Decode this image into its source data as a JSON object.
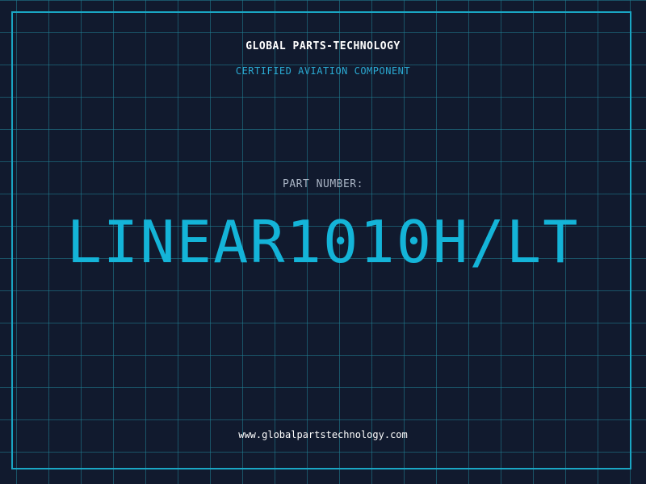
{
  "header": {
    "company_name": "GLOBAL PARTS-TECHNOLOGY",
    "tagline": "CERTIFIED AVIATION COMPONENT"
  },
  "part": {
    "label": "PART NUMBER:",
    "number": "LINEAR1010H/LT"
  },
  "footer": {
    "website": "www.globalpartstechnology.com"
  },
  "colors": {
    "background": "#111a2e",
    "grid": "#208296",
    "accent": "#14b4d8",
    "frame": "#1aa6c4"
  }
}
